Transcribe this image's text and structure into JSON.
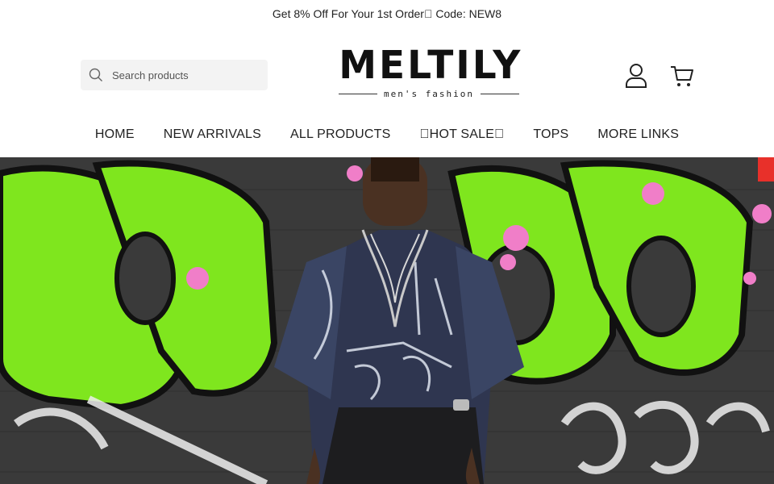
{
  "announcement": "Get 8% Off For Your 1st Order\u0000 Code: NEW8",
  "search": {
    "placeholder": "Search products",
    "icon": "search-icon"
  },
  "logo": {
    "name": "MELTILY",
    "tagline": "men's fashion"
  },
  "header_icons": {
    "account": "user-icon",
    "cart": "cart-icon"
  },
  "nav": {
    "items": [
      {
        "label": "HOME"
      },
      {
        "label": "NEW ARRIVALS"
      },
      {
        "label": "ALL PRODUCTS"
      },
      {
        "label": "\u0000HOT SALE\u0000"
      },
      {
        "label": "TOPS"
      },
      {
        "label": "MORE LINKS"
      }
    ]
  },
  "colors": {
    "text": "#222222",
    "search_bg": "#f3f3f3",
    "hero_green": "#7fe61e"
  }
}
